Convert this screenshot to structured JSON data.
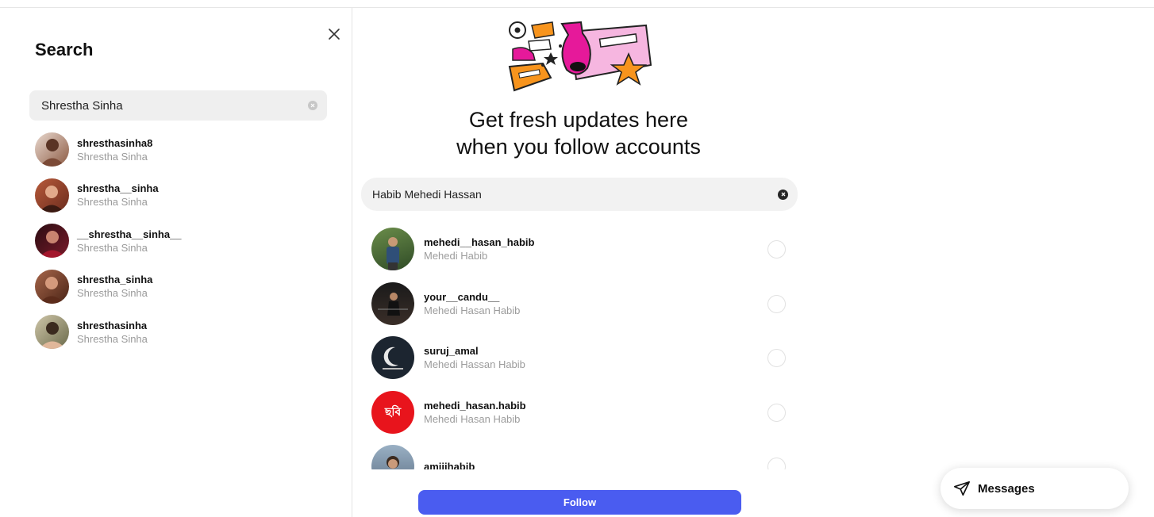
{
  "search_panel": {
    "title": "Search",
    "query": "Shrestha Sinha",
    "results": [
      {
        "username": "shresthasinha8",
        "full_name": "Shrestha Sinha"
      },
      {
        "username": "shrestha__sinha",
        "full_name": "Shrestha Sinha"
      },
      {
        "username": "__shrestha__sinha__",
        "full_name": "Shrestha Sinha"
      },
      {
        "username": "shrestha_sinha",
        "full_name": "Shrestha Sinha"
      },
      {
        "username": "shresthasinha",
        "full_name": "Shrestha Sinha"
      }
    ]
  },
  "feed": {
    "headline_line1": "Get fresh updates here",
    "headline_line2": "when you follow accounts",
    "search_query": "Habib Mehedi Hassan",
    "suggestions": [
      {
        "username": "mehedi__hasan_habib",
        "full_name": "Mehedi Habib"
      },
      {
        "username": "your__candu__",
        "full_name": "Mehedi Hasan Habib"
      },
      {
        "username": "suruj_amal",
        "full_name": "Mehedi Hassan Habib"
      },
      {
        "username": "mehedi_hasan.habib",
        "full_name": "Mehedi Hasan Habib",
        "avatar_text": "ছবি"
      },
      {
        "username": "amiiihabib",
        "full_name": ""
      }
    ],
    "follow_label": "Follow"
  },
  "messages": {
    "label": "Messages"
  },
  "colors": {
    "accent": "#4a5cf0",
    "illustration_pink": "#f06fc8",
    "illustration_orange": "#f7941d",
    "avatar_red": "#e8141c"
  },
  "icons": {
    "close": "close-icon",
    "clear": "clear-icon",
    "messages": "paper-plane-icon"
  }
}
